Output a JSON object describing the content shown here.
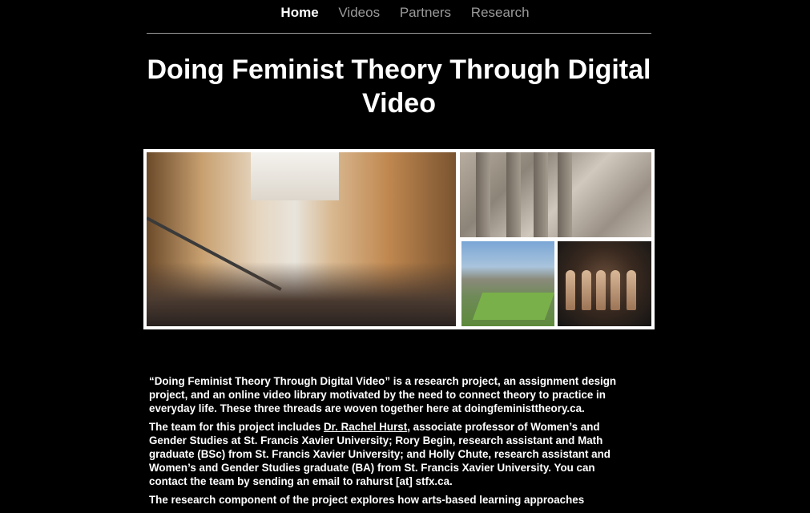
{
  "nav": {
    "items": [
      {
        "label": "Home",
        "active": true
      },
      {
        "label": "Videos",
        "active": false
      },
      {
        "label": "Partners",
        "active": false
      },
      {
        "label": "Research",
        "active": false
      }
    ]
  },
  "page": {
    "title": "Doing Feminist Theory Through Digital Video"
  },
  "gallery": {
    "photos": [
      "street-stairs-photo",
      "stone-arcade-photo",
      "city-park-photo",
      "mannequins-photo"
    ]
  },
  "content": {
    "p1": "“Doing Feminist Theory Through Digital Video” is a research project, an assignment design project, and an online video library motivated by the need to connect theory to practice in everyday life.  These three threads are woven together here at doingfeministtheory.ca.",
    "p2_before": "The team for this project includes ",
    "p2_link": "Dr. Rachel Hurst",
    "p2_after": ", associate professor of Women’s and Gender Studies at St. Francis Xavier University; Rory Begin, research assistant and Math graduate (BSc) from St. Francis Xavier University; and Holly Chute, research assistant and Women’s and Gender Studies graduate (BA) from St. Francis Xavier University.  You can contact the team by sending an email to rahurst [at] stfx.ca.",
    "p3": "The research component of the project explores how arts-based learning approaches"
  }
}
